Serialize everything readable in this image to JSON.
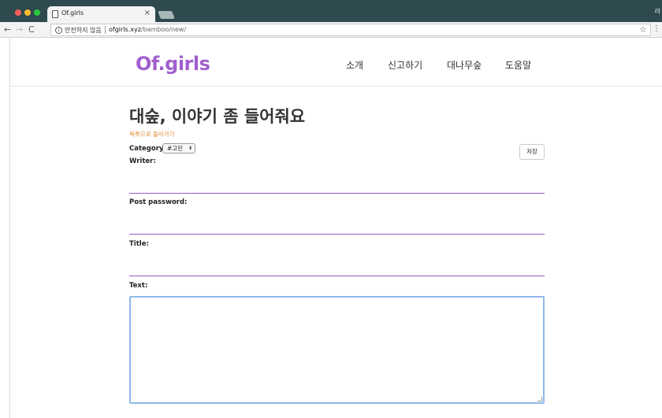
{
  "browser": {
    "tab_title": "Of.girls",
    "tab_close": "×",
    "corner_glyph": "려",
    "nav": {
      "back": "←",
      "forward": "→",
      "reload": "C"
    },
    "omnibox": {
      "info": "i",
      "security_label": "안전하지 않음",
      "url_host": "ofgirls.xyz",
      "url_path": "/bamboo/new/",
      "star": "☆",
      "menu": "⋮"
    }
  },
  "site": {
    "logo": "Of.girls",
    "nav": [
      "소개",
      "신고하기",
      "대나무숲",
      "도움말"
    ]
  },
  "form": {
    "heading": "대숲, 이야기 좀 들어줘요",
    "back_link": "목록으로 돌아가기",
    "category_label": "Category:",
    "category_value": "#고민",
    "category_arrow": "⬍",
    "save_label": "저장",
    "writer_label": "Writer:",
    "password_label": "Post password:",
    "title_label": "Title:",
    "text_label": "Text:"
  },
  "colors": {
    "logo": "#a15fcf",
    "underline": "#9b59c6",
    "link": "#e08a2f",
    "focus": "#8fb7ea",
    "titlebar": "#2e4a4e"
  }
}
